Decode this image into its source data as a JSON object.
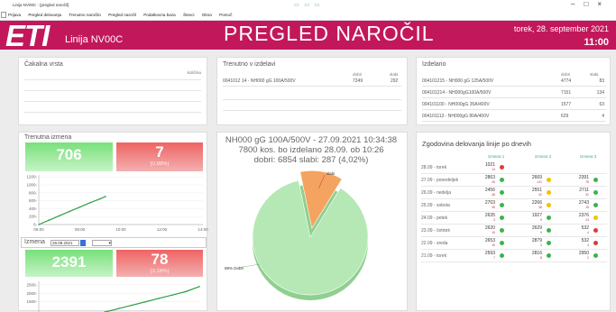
{
  "window": {
    "title": "Linija NV00C - [pregled naročil]",
    "controls": [
      "–",
      "□",
      "×"
    ]
  },
  "menu": [
    "Prijava",
    "Pregled delovanja",
    "Trenutno naročilo",
    "Pregled naročil",
    "Podatkovna baza",
    "Števci",
    "Okna",
    "Pomoč"
  ],
  "header": {
    "logo": "ETI",
    "line": "Linija NV00C",
    "title": "PREGLED NAROČIL",
    "date": "torek, 28. september 2021",
    "time": "11:00"
  },
  "queue": {
    "title": "Čakalna vrsta",
    "col_qty": "količina"
  },
  "current": {
    "title": "Trenutno v izdelavi",
    "cols": [
      "dobri",
      "slabi"
    ],
    "rows": [
      {
        "name": "0041012 14 - NH000 gG 100A/500V",
        "good": "7249",
        "bad": "292"
      }
    ]
  },
  "done": {
    "title": "Izdelano",
    "cols": [
      "dobri",
      "slabi"
    ],
    "rows": [
      {
        "name": "004101215 - NH000 gG 125A/500V",
        "good": "4774",
        "bad": "83"
      },
      {
        "name": "004101214 - NH000gG100A/500V",
        "good": "7151",
        "bad": "134"
      },
      {
        "name": "004101100 - NH000gG 35A/400V",
        "good": "1577",
        "bad": "63"
      },
      {
        "name": "004101113 - NH000gG 80A/400V",
        "good": "629",
        "bad": "4"
      }
    ]
  },
  "shift": {
    "title": "Trenutna izmena",
    "good": "706",
    "bad": "7",
    "bad_pct": "(0,98%)"
  },
  "shift2": {
    "label": "Izmena",
    "date": "28.09.2021",
    "good": "2391",
    "bad": "78",
    "bad_pct": "(3,16%)"
  },
  "chart_data": [
    {
      "type": "line",
      "title": "",
      "x_ticks": [
        "06:00",
        "08:00",
        "10:00",
        "12:00",
        "14:00"
      ],
      "y_ticks": [
        "0",
        "200",
        "400",
        "600",
        "800",
        "1000",
        "1200"
      ],
      "ylim": [
        0,
        1250
      ],
      "x": [
        "06:00",
        "06:30",
        "07:00",
        "07:30",
        "08:00",
        "08:30",
        "09:00",
        "09:15"
      ],
      "values": [
        0,
        110,
        220,
        330,
        440,
        550,
        650,
        706
      ],
      "color": "#2e9e48"
    },
    {
      "type": "line",
      "title": "",
      "y_ticks": [
        "1000",
        "1500",
        "2000",
        "2500"
      ],
      "ylim": [
        800,
        2700
      ],
      "values": [
        900,
        1100,
        1300,
        1500,
        1700,
        1900,
        2100,
        2391
      ],
      "color": "#2e9e48"
    },
    {
      "type": "pie",
      "title": "NH000 gG 100A/500V - 27.09.2021 10:34:38",
      "subtitle": "7800 kos. bo izdelano 28.09. ob 10:26",
      "subtitle2": "dobri: 6854   slabi: 287 (4,02%)",
      "slices": [
        {
          "label": "88% Dobri",
          "value": 88,
          "color": "#b5e8b5"
        },
        {
          "label": "slabi",
          "value": 12,
          "color": "#f4a460"
        }
      ]
    }
  ],
  "history": {
    "title": "Zgodovina delovanja linije po dnevih",
    "heads": [
      "izmena 1",
      "izmena 2",
      "izmena 3"
    ],
    "colors": {
      "green": "#3cb44b",
      "yellow": "#f2c200",
      "red": "#e03a3a"
    },
    "rows": [
      {
        "day": "28.09 - torek",
        "cells": [
          {
            "v": "1021",
            "s": "14",
            "c": "red"
          },
          null,
          null
        ]
      },
      {
        "day": "27.09 - ponedeljek",
        "cells": [
          {
            "v": "2863",
            "s": "26",
            "c": "green"
          },
          {
            "v": "2669",
            "s": "141",
            "c": "yellow"
          },
          {
            "v": "2391",
            "s": "78",
            "c": "green"
          }
        ]
      },
      {
        "day": "26.09 - nedelja",
        "cells": [
          {
            "v": "2456",
            "s": "48",
            "c": "green"
          },
          {
            "v": "2551",
            "s": "42",
            "c": "yellow"
          },
          {
            "v": "2711",
            "s": "31",
            "c": "green"
          }
        ]
      },
      {
        "day": "25.09 - sobota",
        "cells": [
          {
            "v": "2703",
            "s": "35",
            "c": "green"
          },
          {
            "v": "2266",
            "s": "36",
            "c": "yellow"
          },
          {
            "v": "2743",
            "s": "15",
            "c": "green"
          }
        ]
      },
      {
        "day": "24.09 - petek",
        "cells": [
          {
            "v": "2635",
            "s": "3",
            "c": "green"
          },
          {
            "v": "1927",
            "s": "9",
            "c": "green"
          },
          {
            "v": "2376",
            "s": "23",
            "c": "yellow"
          }
        ]
      },
      {
        "day": "23.09 - četrtek",
        "cells": [
          {
            "v": "2620",
            "s": "19",
            "c": "green"
          },
          {
            "v": "2629",
            "s": "9",
            "c": "green"
          },
          {
            "v": "532",
            "s": "4",
            "c": "red"
          }
        ]
      },
      {
        "day": "22.09 - sreda",
        "cells": [
          {
            "v": "2653",
            "s": "15",
            "c": "green"
          },
          {
            "v": "2879",
            "s": "3",
            "c": "green"
          },
          {
            "v": "532",
            "s": "4",
            "c": "red"
          }
        ]
      },
      {
        "day": "21.09 - torek",
        "cells": [
          {
            "v": "2593",
            "s": "7",
            "c": "green"
          },
          {
            "v": "2816",
            "s": "8",
            "c": "green"
          },
          {
            "v": "2950",
            "s": "2",
            "c": "green"
          }
        ]
      }
    ]
  }
}
